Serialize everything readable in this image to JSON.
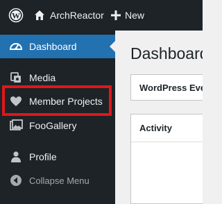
{
  "admin_bar": {
    "wp_logo_icon": "wordpress-logo-icon",
    "site_name": "ArchReactor",
    "site_icon": "home-icon",
    "new_label": "New",
    "new_icon": "plus-icon"
  },
  "sidebar": {
    "items": [
      {
        "label": "Dashboard",
        "icon": "dashboard-gauge-icon",
        "current": true
      },
      {
        "label": "Media",
        "icon": "media-icon"
      },
      {
        "label": "Member Projects",
        "icon": "heart-icon",
        "highlighted": true
      },
      {
        "label": "FooGallery",
        "icon": "gallery-icon"
      },
      {
        "label": "Profile",
        "icon": "user-icon"
      },
      {
        "label": "Collapse Menu",
        "icon": "collapse-arrow-icon"
      }
    ],
    "highlight_color": "#e0161b",
    "current_color": "#2271b1"
  },
  "main": {
    "title": "Dashboard",
    "panels": [
      {
        "title": "WordPress Eve"
      },
      {
        "title": "Activity"
      }
    ]
  }
}
